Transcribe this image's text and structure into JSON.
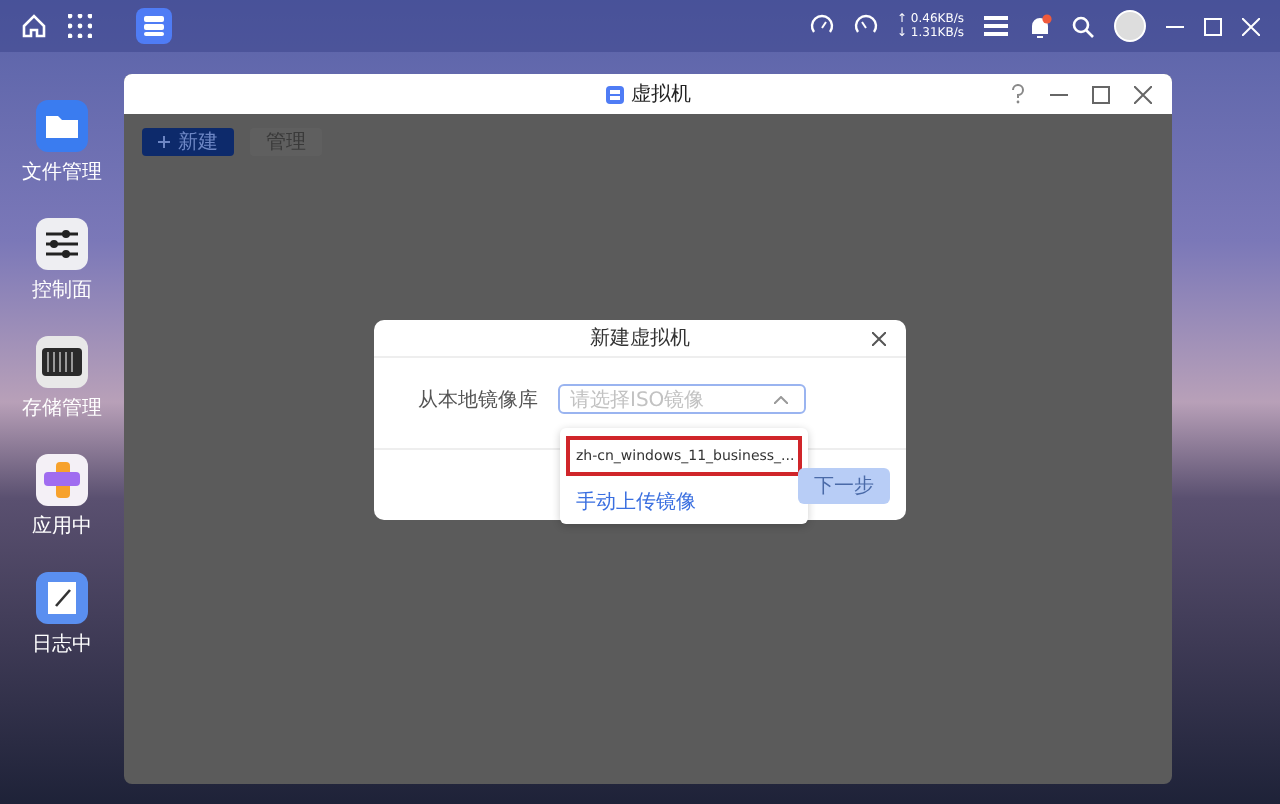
{
  "taskbar": {
    "network": {
      "upload": "↑ 0.46KB/s",
      "download": "↓ 1.31KB/s"
    },
    "notification_badge": true
  },
  "desktop_icons": [
    {
      "label": "文件管理",
      "kind": "folder"
    },
    {
      "label": "控制面",
      "kind": "sliders"
    },
    {
      "label": "存储管理",
      "kind": "storage"
    },
    {
      "label": "应用中",
      "kind": "apps"
    },
    {
      "label": "日志中",
      "kind": "log"
    }
  ],
  "window": {
    "title": "虚拟机",
    "toolbar": [
      {
        "label": "新建",
        "kind": "primary"
      },
      {
        "label": "管理",
        "kind": "plain"
      }
    ],
    "dialog": {
      "title": "新建虚拟机",
      "field_label": "从本地镜像库",
      "select": {
        "placeholder": "请选择ISO镜像",
        "expanded": true
      },
      "options": [
        {
          "label": "zh-cn_windows_11_business_...",
          "highlighted": true
        }
      ],
      "upload_link": "手动上传镜像",
      "next_button": {
        "label": "下一步",
        "disabled": true
      }
    }
  }
}
